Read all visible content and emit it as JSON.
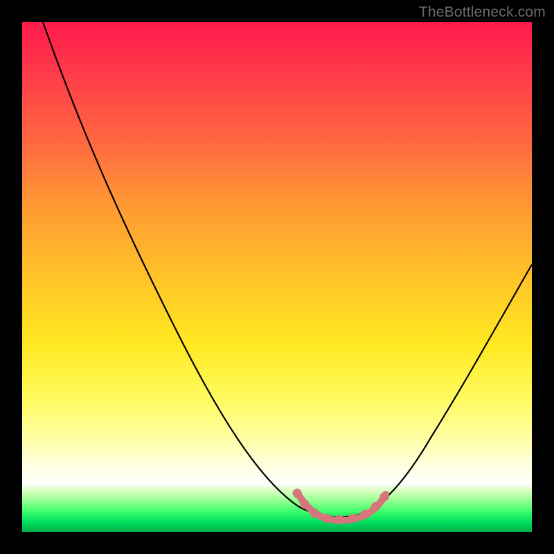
{
  "watermark": "TheBottleneck.com",
  "chart_data": {
    "type": "line",
    "title": "",
    "xlabel": "",
    "ylabel": "",
    "xlim": [
      0,
      100
    ],
    "ylim": [
      0,
      100
    ],
    "grid": false,
    "legend": false,
    "series": [
      {
        "name": "bottleneck-curve",
        "color": "#000000",
        "x": [
          4,
          10,
          18,
          26,
          34,
          42,
          50,
          54,
          58,
          62,
          66,
          68,
          70,
          74,
          80,
          86,
          92,
          98
        ],
        "y": [
          100,
          88,
          74,
          60,
          46,
          32,
          18,
          12,
          8,
          5,
          3,
          3,
          4,
          8,
          18,
          32,
          46,
          60
        ]
      }
    ],
    "marker_segment": {
      "name": "optimal-range",
      "color": "#d4767b",
      "x": [
        54,
        58,
        62,
        66,
        68,
        70,
        72
      ],
      "y": [
        11,
        7,
        4.5,
        3,
        3,
        3.5,
        6
      ]
    }
  }
}
